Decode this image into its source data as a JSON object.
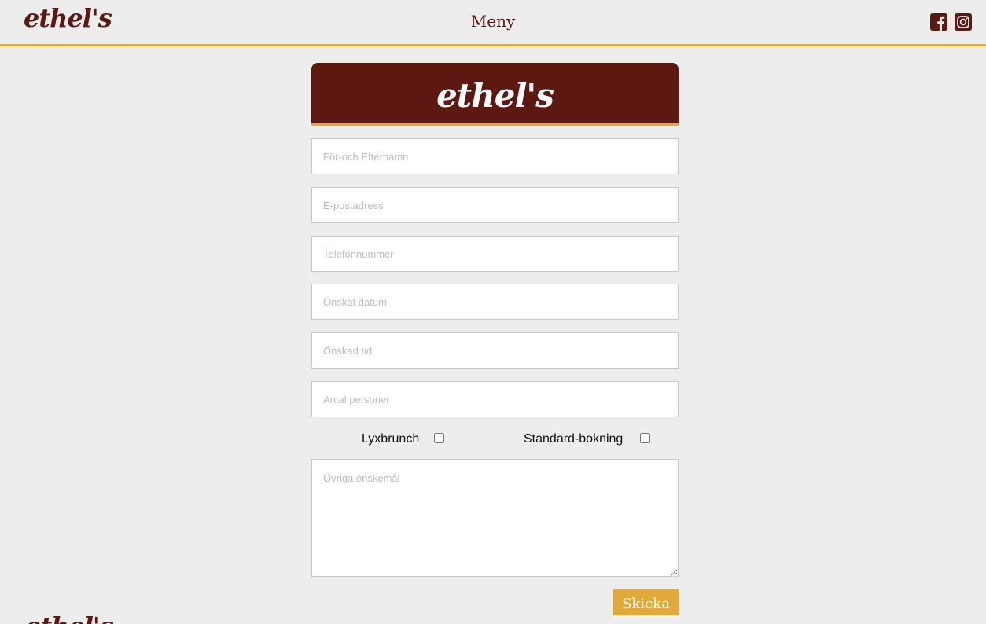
{
  "header": {
    "logo": "ethel's",
    "nav_menu": "Meny",
    "social_icons": [
      "facebook-icon",
      "instagram-icon"
    ]
  },
  "banner": {
    "logo": "ethel's"
  },
  "form": {
    "fields": {
      "name_placeholder": "För-och Efternamn",
      "email_placeholder": "E-postadress",
      "phone_placeholder": "Telefonnummer",
      "date_placeholder": "Önskat datum",
      "time_placeholder": "Önskad tid",
      "guests_placeholder": "Antal personer",
      "notes_placeholder": "Övriga önskemål"
    },
    "checkboxes": {
      "lux_label": "Lyxbrunch",
      "lux_checked": false,
      "standard_label": "Standard-bokning",
      "standard_checked": false
    },
    "submit_label": "Skicka"
  },
  "footer": {
    "logo": "ethel's"
  },
  "colors": {
    "brand_dark": "#5e1812",
    "accent": "#e0a93a",
    "background": "#ededed"
  }
}
